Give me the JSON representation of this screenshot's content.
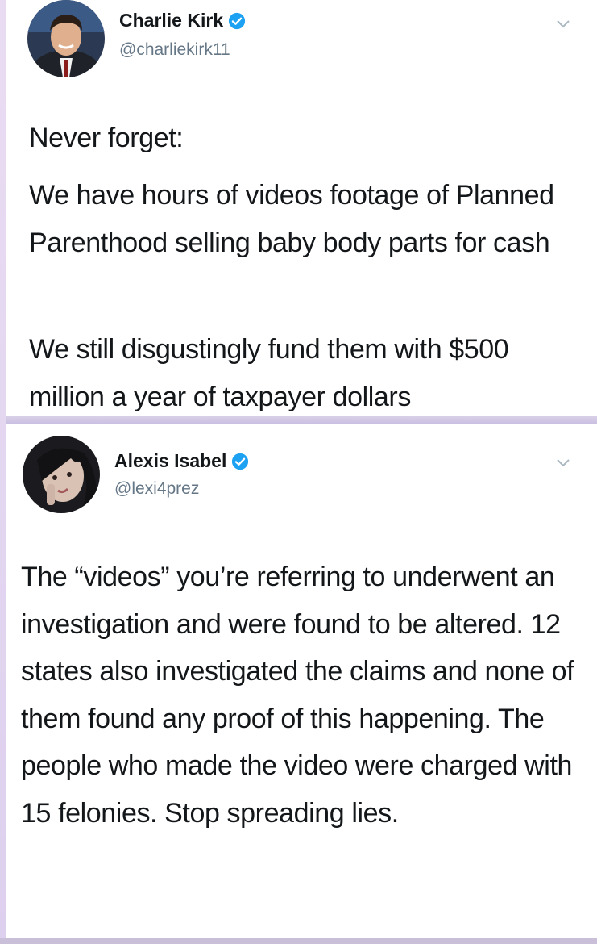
{
  "tweets": [
    {
      "author_name": "Charlie Kirk",
      "handle": "@charliekirk11",
      "verified": true,
      "paragraphs": [
        "Never forget:",
        "We have hours of videos footage of Planned Parenthood selling baby body parts for cash",
        "We still disgustingly fund them with $500 million a year of taxpayer dollars"
      ]
    },
    {
      "author_name": "Alexis Isabel",
      "handle": "@lexi4prez",
      "verified": true,
      "paragraphs": [
        "The “videos” you’re referring to underwent an investigation and were found to be altered. 12 states also investigated the claims and none of them found any proof of this happening. The people who made the video were charged with 15 felonies. Stop spreading lies."
      ]
    }
  ],
  "icons": {
    "verified": "verified-badge-icon",
    "more": "chevron-down-icon"
  },
  "colors": {
    "verified_blue": "#1da1f2",
    "handle_gray": "#657786",
    "text": "#14171a"
  }
}
